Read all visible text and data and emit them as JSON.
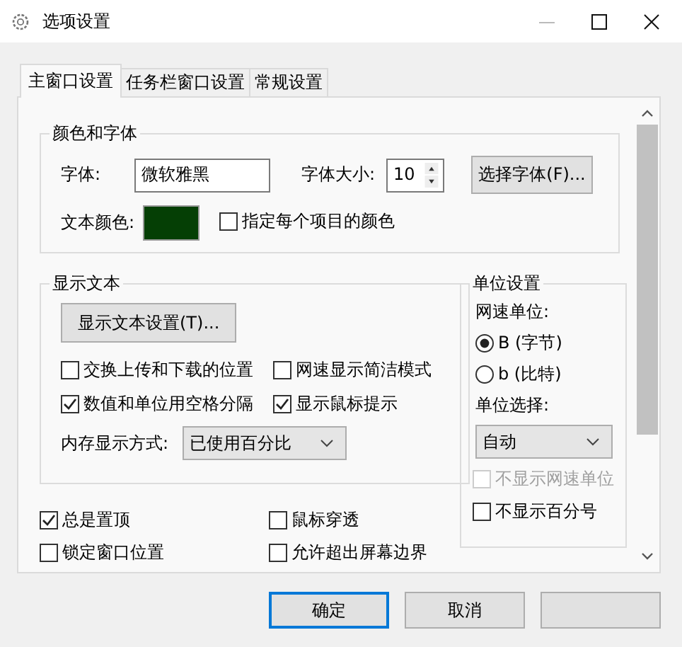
{
  "window": {
    "title": "选项设置"
  },
  "tabs": [
    {
      "label": "主窗口设置",
      "selected": true
    },
    {
      "label": "任务栏窗口设置",
      "selected": false
    },
    {
      "label": "常规设置",
      "selected": false
    }
  ],
  "font_group": {
    "title": "颜色和字体",
    "font_label": "字体:",
    "font_value": "微软雅黑",
    "size_label": "字体大小:",
    "size_value": "10",
    "choose_button": "选择字体(F)...",
    "color_label": "文本颜色:",
    "color": "#053f05",
    "per_item_color": {
      "label": "指定每个项目的颜色",
      "checked": false
    }
  },
  "display_group": {
    "title": "显示文本",
    "settings_button": "显示文本设置(T)...",
    "options": [
      {
        "label": "交换上传和下载的位置",
        "checked": false
      },
      {
        "label": "网速显示简洁模式",
        "checked": false
      },
      {
        "label": "数值和单位用空格分隔",
        "checked": true
      },
      {
        "label": "显示鼠标提示",
        "checked": true
      }
    ],
    "memory_label": "内存显示方式:",
    "memory_value": "已使用百分比"
  },
  "unit_group": {
    "title": "单位设置",
    "speed_unit_label": "网速单位:",
    "speed_units": [
      {
        "label": "B (字节)",
        "selected": true
      },
      {
        "label": "b (比特)",
        "selected": false
      }
    ],
    "unit_select_label": "单位选择:",
    "unit_select_value": "自动",
    "options": [
      {
        "label": "不显示网速单位",
        "checked": false,
        "disabled": true
      },
      {
        "label": "不显示百分号",
        "checked": false,
        "disabled": false
      }
    ]
  },
  "window_options": [
    {
      "label": "总是置顶",
      "checked": true
    },
    {
      "label": "鼠标穿透",
      "checked": false
    },
    {
      "label": "锁定窗口位置",
      "checked": false
    },
    {
      "label": "允许超出屏幕边界",
      "checked": false
    }
  ],
  "buttons": [
    {
      "label": "确定",
      "default": true
    },
    {
      "label": "取消",
      "default": false
    },
    {
      "default": false
    }
  ]
}
